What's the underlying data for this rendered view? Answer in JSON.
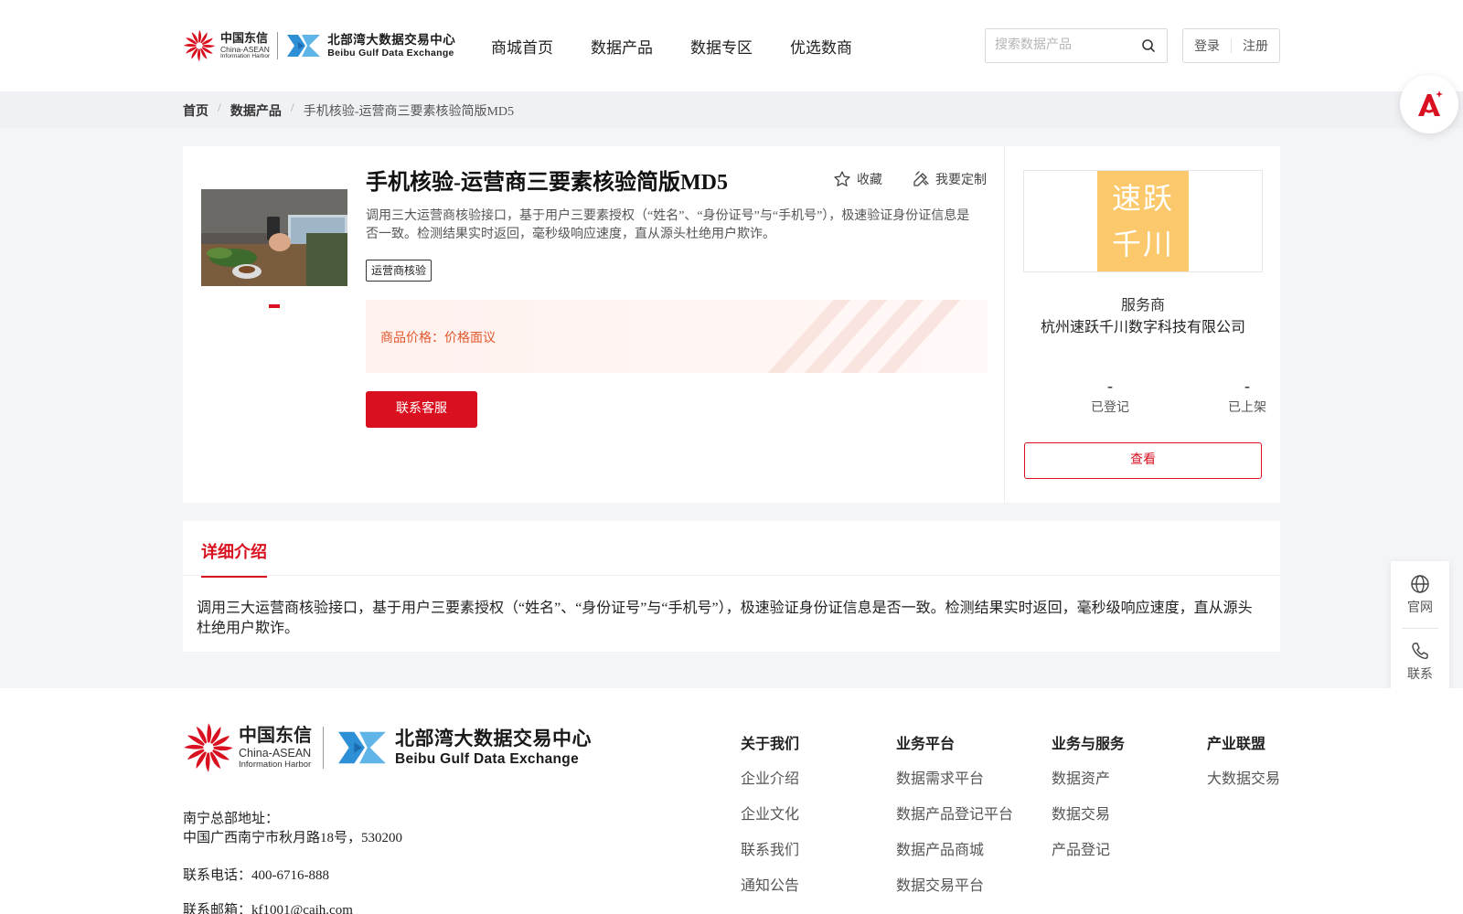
{
  "header": {
    "logo": {
      "cn_name": "中国东信",
      "cn_en1": "China-ASEAN",
      "cn_en2": "Information Harbor",
      "bb_name": "北部湾大数据交易中心",
      "bb_en": "Beibu Gulf Data Exchange"
    },
    "nav": [
      "商城首页",
      "数据产品",
      "数据专区",
      "优选数商"
    ],
    "search_placeholder": "搜索数据产品",
    "login": "登录",
    "register": "注册"
  },
  "breadcrumb": {
    "home": "首页",
    "category": "数据产品",
    "current": "手机核验-运营商三要素核验简版MD5",
    "sep": "/"
  },
  "product": {
    "title": "手机核验-运营商三要素核验简版MD5",
    "favorite": "收藏",
    "customize": "我要定制",
    "description": "调用三大运营商核验接口，基于用户三要素授权（“姓名”、“身份证号”与“手机号”），极速验证身份证信息是否一致。检测结果实时返回，毫秒级响应速度，直从源头杜绝用户欺诈。",
    "tag": "运营商核验",
    "price_label": "商品价格：",
    "price_value": "价格面议",
    "contact_button": "联系客服"
  },
  "vendor": {
    "logo_text": "速跃千川",
    "role": "服务商",
    "name": "杭州速跃千川数字科技有限公司",
    "registered_count": "-",
    "registered_label": "已登记",
    "listed_count": "-",
    "listed_label": "已上架",
    "view_button": "查看"
  },
  "detail": {
    "tab": "详细介绍",
    "text": "调用三大运营商核验接口，基于用户三要素授权（“姓名”、“身份证号”与“手机号”），极速验证身份证信息是否一致。检测结果实时返回，毫秒级响应速度，直从源头杜绝用户欺诈。"
  },
  "side": {
    "website": "官网",
    "contact": "联系"
  },
  "footer": {
    "address_label": "南宁总部地址：",
    "address": "中国广西南宁市秋月路18号，530200",
    "phone": "联系电话：400-6716-888",
    "email": "联系邮箱：kf1001@caih.com",
    "columns": [
      {
        "title": "关于我们",
        "items": [
          "企业介绍",
          "企业文化",
          "联系我们",
          "通知公告"
        ]
      },
      {
        "title": "业务平台",
        "items": [
          "数据需求平台",
          "数据产品登记平台",
          "数据产品商城",
          "数据交易平台"
        ]
      },
      {
        "title": "业务与服务",
        "items": [
          "数据资产",
          "数据交易",
          "产品登记"
        ]
      },
      {
        "title": "产业联盟",
        "items": [
          "大数据交易"
        ]
      }
    ]
  },
  "colors": {
    "brand_red": "#d9101f",
    "price_orange": "#e2582c",
    "vendor_logo_bg": "#fbc96c",
    "bb_blue": "#2d8fd5"
  }
}
